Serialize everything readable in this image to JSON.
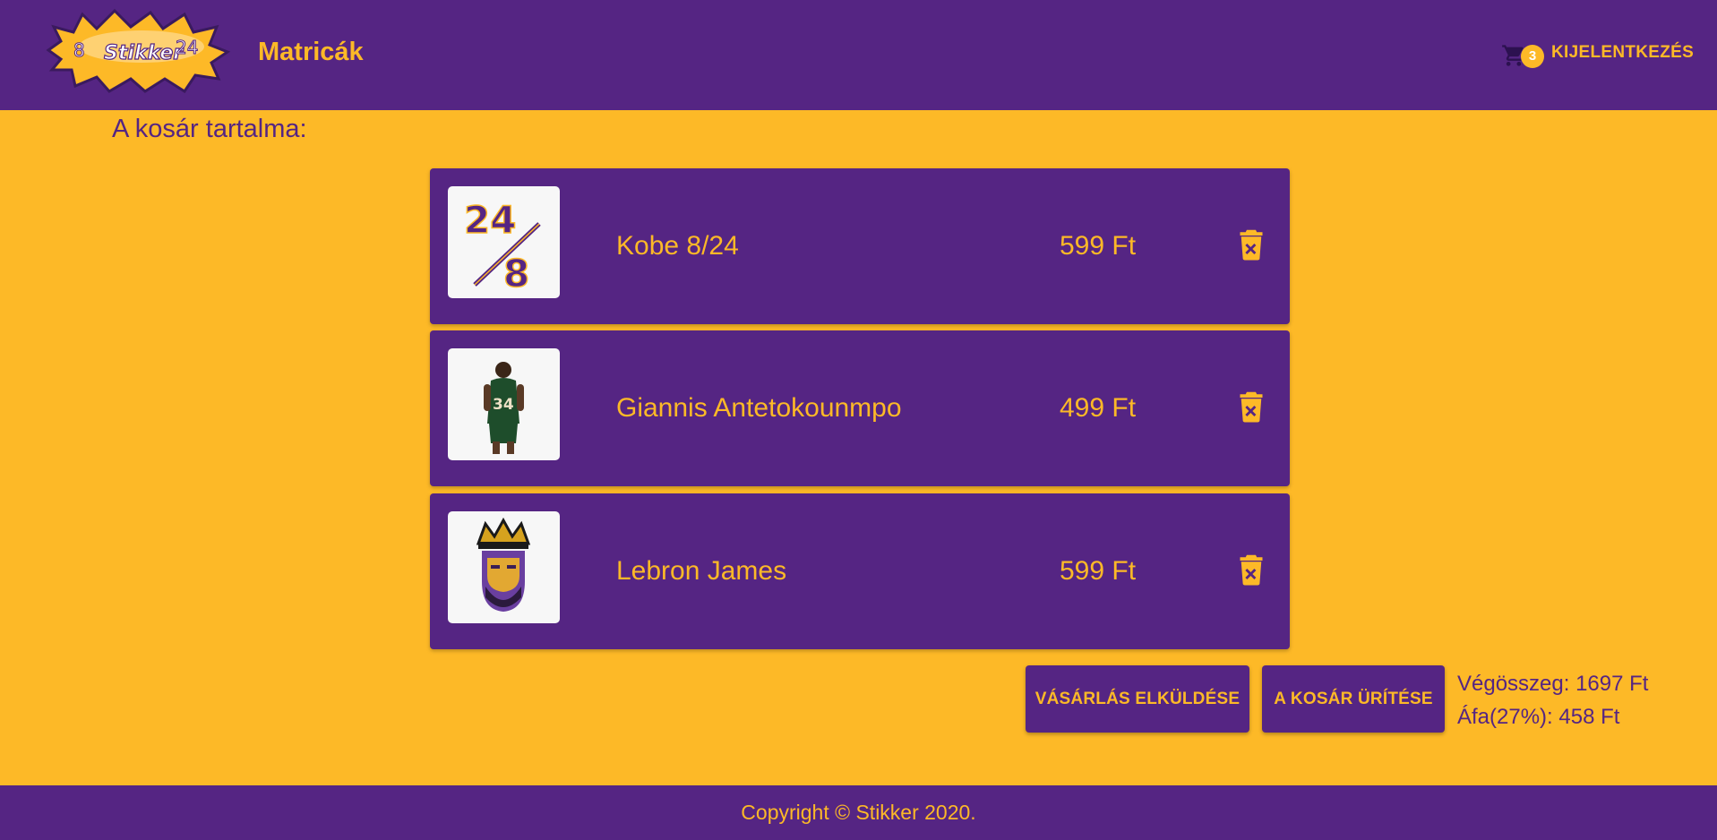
{
  "header": {
    "logo": {
      "left_number": "8",
      "text": "Stikker",
      "right_number": "24"
    },
    "title": "Matricák",
    "cart_count": "3",
    "logout_label": "KIJELENTKEZÉS",
    "cart_icon": "shopping-cart-icon"
  },
  "main": {
    "heading": "A kosár tartalma:",
    "items": [
      {
        "name": "Kobe 8/24",
        "price": "599 Ft",
        "image": "kobe-8-24-sticker"
      },
      {
        "name": "Giannis Antetokounmpo",
        "price": "499 Ft",
        "image": "giannis-jersey-sticker"
      },
      {
        "name": "Lebron James",
        "price": "599 Ft",
        "image": "lebron-crown-sticker"
      }
    ],
    "delete_icon": "trash-x-icon",
    "submit_label": "VÁSÁRLÁS ELKÜLDÉSE",
    "clear_label": "A KOSÁR ÜRÍTÉSE",
    "total": "Végösszeg: 1697 Ft",
    "vat": "Áfa(27%): 458 Ft"
  },
  "footer": {
    "copyright": "Copyright © Stikker 2020."
  },
  "colors": {
    "purple": "#552583",
    "gold": "#FDB927"
  }
}
